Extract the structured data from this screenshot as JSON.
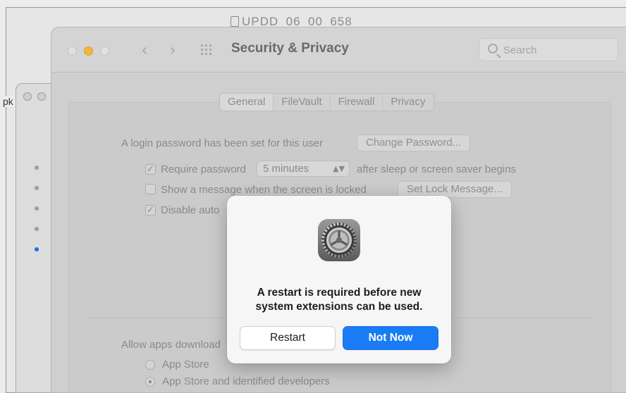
{
  "background_window": {
    "title": "UPDD_06_00_658"
  },
  "side_window": {
    "label": "pk"
  },
  "prefs": {
    "title": "Security & Privacy",
    "search_placeholder": "Search",
    "tabs": [
      {
        "label": "General",
        "selected": true
      },
      {
        "label": "FileVault",
        "selected": false
      },
      {
        "label": "Firewall",
        "selected": false
      },
      {
        "label": "Privacy",
        "selected": false
      }
    ],
    "login_text": "A login password has been set for this user",
    "change_password_button": "Change Password...",
    "require_password_label": "Require password",
    "require_password_checked": true,
    "require_password_value": "5 minutes",
    "after_sleep_text": "after sleep or screen saver begins",
    "show_message_label": "Show a message when the screen is locked",
    "show_message_checked": false,
    "set_lock_message_button": "Set Lock Message...",
    "disable_auto_label": "Disable auto",
    "disable_auto_checked": true,
    "allow_apps_label": "Allow apps download",
    "radio_options": [
      {
        "label": "App Store",
        "selected": false
      },
      {
        "label": "App Store and identified developers",
        "selected": true
      }
    ]
  },
  "dialog": {
    "message": "A restart is required before new system extensions can be used.",
    "restart_button": "Restart",
    "not_now_button": "Not Now"
  },
  "colors": {
    "accent_blue": "#1a7cf5",
    "minimize_yellow": "#f0b83a",
    "sidebar_active_dot": "#1e6df0"
  }
}
